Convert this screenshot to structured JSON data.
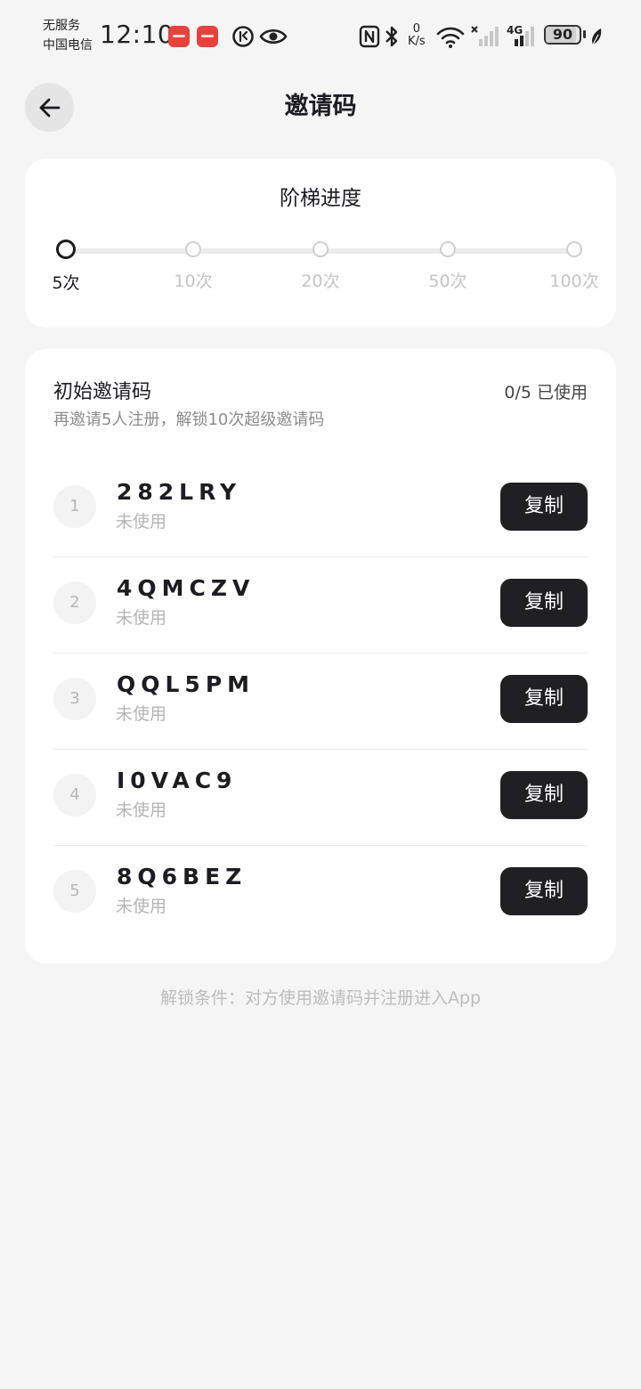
{
  "status_bar": {
    "carrier_line1": "无服务",
    "carrier_line2": "中国电信",
    "time": "12:10",
    "net_speed_value": "0",
    "net_speed_unit": "K/s",
    "network_type": "4G",
    "battery": "90",
    "battery_level": 0.9
  },
  "header": {
    "title": "邀请码"
  },
  "progress": {
    "title": "阶梯进度",
    "tiers": [
      "5次",
      "10次",
      "20次",
      "50次",
      "100次"
    ],
    "active_index": 0
  },
  "codes": {
    "heading": "初始邀请码",
    "usage": "0/5 已使用",
    "subtitle": "再邀请5人注册，解锁10次超级邀请码",
    "copy_label": "复制",
    "items": [
      {
        "index": "1",
        "code": "282LRY",
        "status": "未使用"
      },
      {
        "index": "2",
        "code": "4QMCZV",
        "status": "未使用"
      },
      {
        "index": "3",
        "code": "QQL5PM",
        "status": "未使用"
      },
      {
        "index": "4",
        "code": "I0VAC9",
        "status": "未使用"
      },
      {
        "index": "5",
        "code": "8Q6BEZ",
        "status": "未使用"
      }
    ]
  },
  "footnote": "解锁条件：对方使用邀请码并注册进入App",
  "colors": {
    "background": "#f5f5f5",
    "card": "#ffffff",
    "primary": "#1f1f24",
    "muted": "#b4b4b4"
  }
}
